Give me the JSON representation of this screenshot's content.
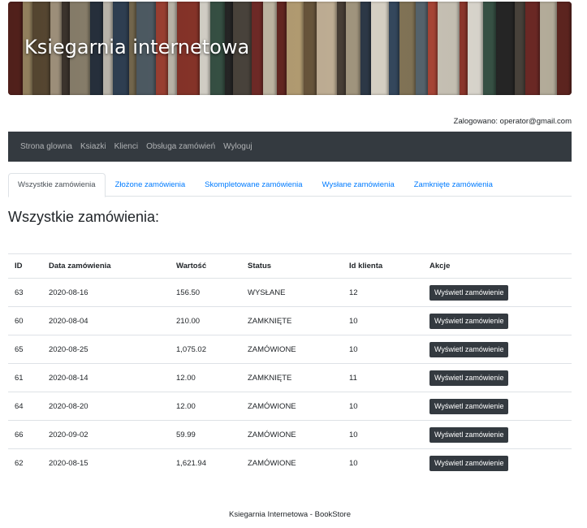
{
  "header": {
    "title": "Ksiegarnia internetowa",
    "login_info": "Zalogowano: operator@gmail.com"
  },
  "navbar": {
    "items": [
      "Strona glowna",
      "Ksiazki",
      "Klienci",
      "Obsługa zamówień",
      "Wyloguj"
    ]
  },
  "tabs": [
    {
      "label": "Wszystkie zamówienia",
      "active": true
    },
    {
      "label": "Złożone zamówienia",
      "active": false
    },
    {
      "label": "Skompletowane zamówienia",
      "active": false
    },
    {
      "label": "Wysłane zamówienia",
      "active": false
    },
    {
      "label": "Zamknięte zamówienia",
      "active": false
    }
  ],
  "page_title": "Wszystkie zamówienia:",
  "table": {
    "headers": [
      "ID",
      "Data zamówienia",
      "Wartość",
      "Status",
      "Id klienta",
      "Akcje"
    ],
    "rows": [
      {
        "id": "63",
        "date": "2020-08-16",
        "value": "156.50",
        "status": "WYSŁANE",
        "client": "12",
        "action": "Wyświetl zamówienie"
      },
      {
        "id": "60",
        "date": "2020-08-04",
        "value": "210.00",
        "status": "ZAMKNIĘTE",
        "client": "10",
        "action": "Wyświetl zamówienie"
      },
      {
        "id": "65",
        "date": "2020-08-25",
        "value": "1,075.02",
        "status": "ZAMÓWIONE",
        "client": "10",
        "action": "Wyświetl zamówienie"
      },
      {
        "id": "61",
        "date": "2020-08-14",
        "value": "12.00",
        "status": "ZAMKNIĘTE",
        "client": "11",
        "action": "Wyświetl zamówienie"
      },
      {
        "id": "64",
        "date": "2020-08-20",
        "value": "12.00",
        "status": "ZAMÓWIONE",
        "client": "10",
        "action": "Wyświetl zamówienie"
      },
      {
        "id": "66",
        "date": "2020-09-02",
        "value": "59.99",
        "status": "ZAMÓWIONE",
        "client": "10",
        "action": "Wyświetl zamówienie"
      },
      {
        "id": "62",
        "date": "2020-08-15",
        "value": "1,621.94",
        "status": "ZAMÓWIONE",
        "client": "10",
        "action": "Wyświetl zamówienie"
      }
    ]
  },
  "footer": "Ksiegarnia Internetowa - BookStore",
  "colors": {
    "navbar_bg": "#343a40",
    "link": "#007bff",
    "button_bg": "#343a40"
  }
}
